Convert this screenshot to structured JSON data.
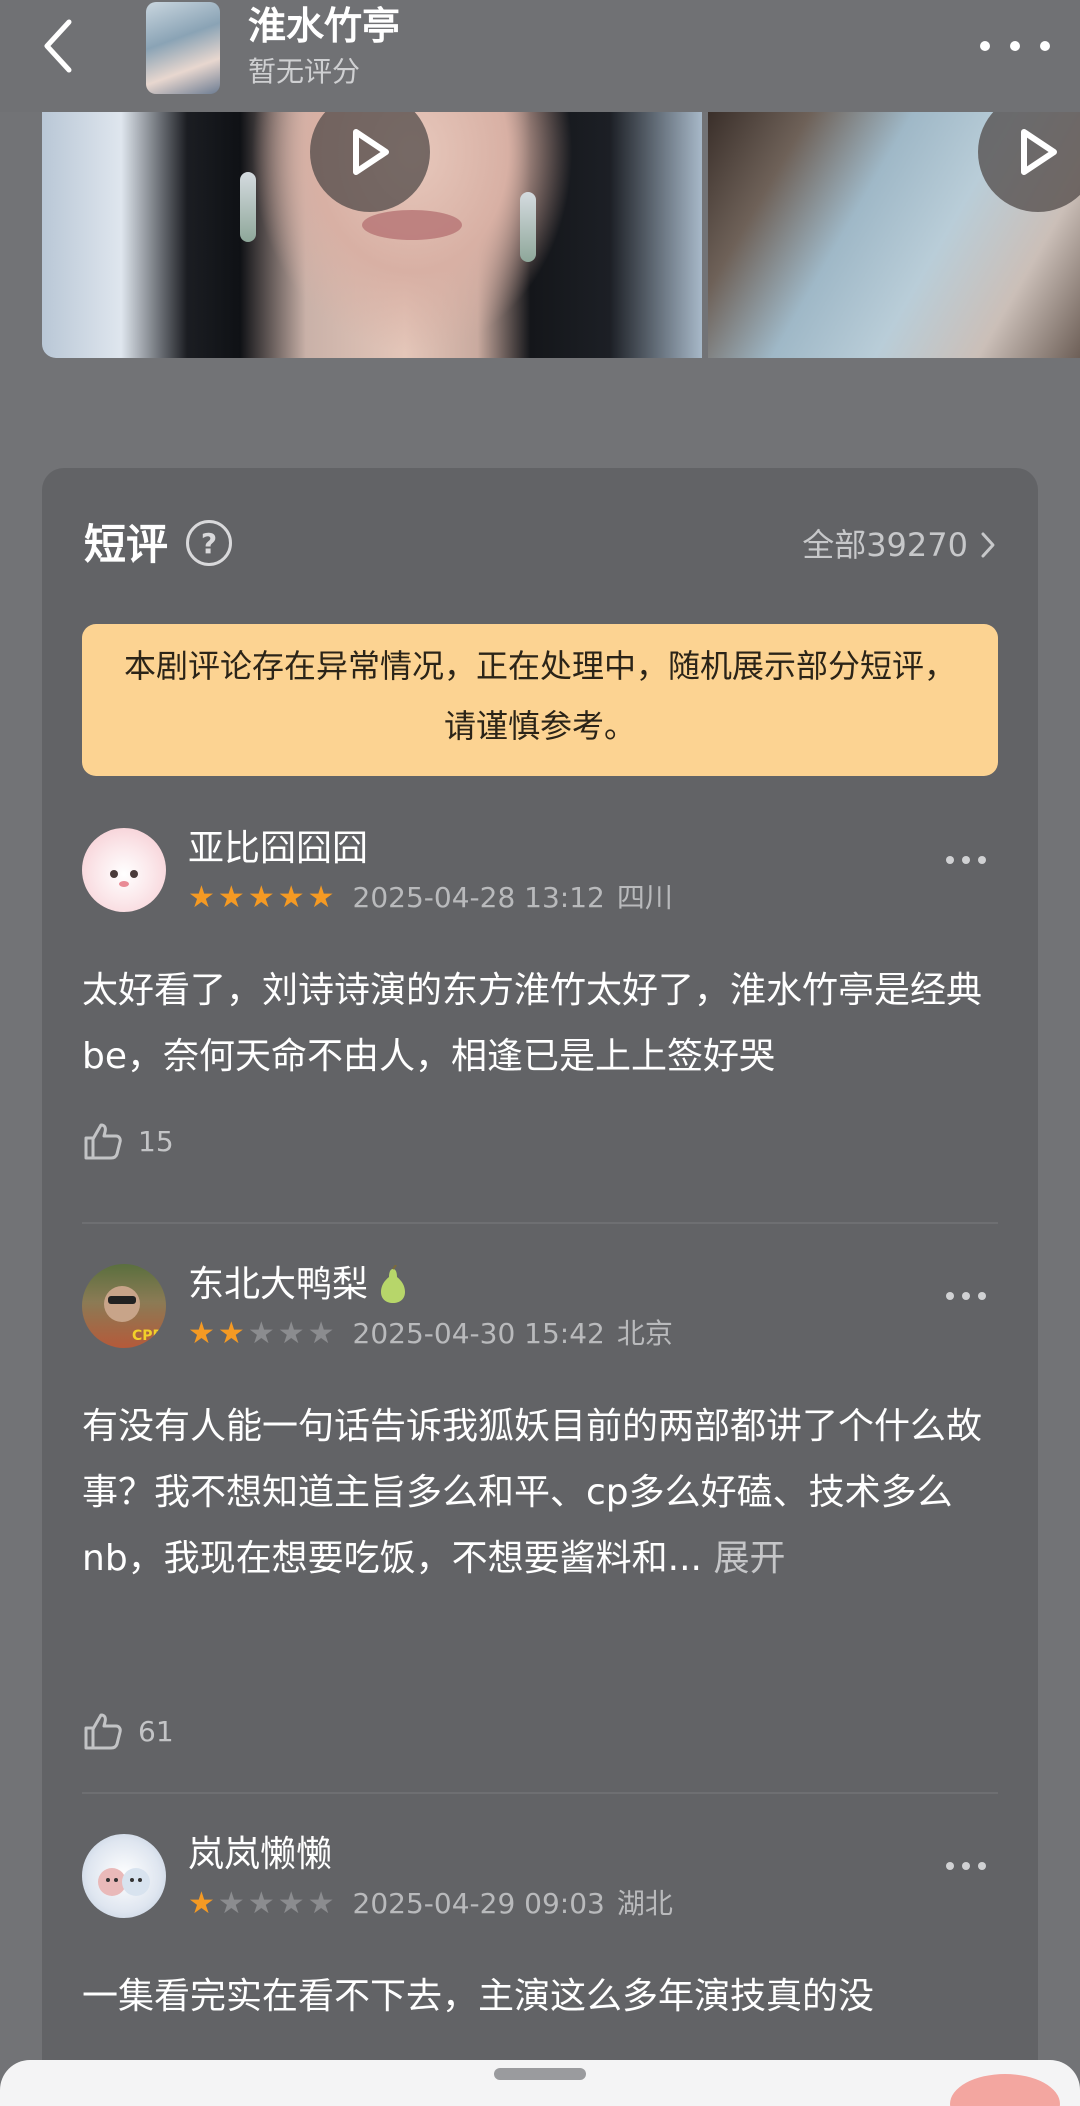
{
  "header": {
    "title": "淮水竹亭",
    "subtitle": "暂无评分"
  },
  "short_reviews": {
    "title": "短评",
    "help_icon": "?",
    "all_link": "全部39270",
    "notice": "本剧评论存在异常情况，正在处理中，随机展示部分短评，请谨慎参考。",
    "items": [
      {
        "username": "亚比囧囧囧",
        "badge": "",
        "rating": 5,
        "time": "2025-04-28 13:12",
        "location": "四川",
        "text": "太好看了，刘诗诗演的东方淮竹太好了，淮水竹亭是经典be，奈何天命不由人，相逢已是上上签好哭",
        "expand": "",
        "likes": "15"
      },
      {
        "username": "东北大鸭梨",
        "badge": "pear-icon",
        "rating": 2,
        "time": "2025-04-30 15:42",
        "location": "北京",
        "text": "有没有人能一句话告诉我狐妖目前的两部都讲了个什么故事？我不想知道主旨多么和平、cp多么好磕、技术多么nb，我现在想要吃饭，不想要酱料和...",
        "expand": "展开",
        "likes": "61"
      },
      {
        "username": "岚岚懒懒",
        "badge": "",
        "rating": 1,
        "time": "2025-04-29 09:03",
        "location": "湖北",
        "text": "一集看完实在看不下去，主演这么多年演技真的没",
        "expand": "",
        "likes": ""
      }
    ]
  },
  "colors": {
    "star_on": "#f59a23",
    "notice_bg": "#fcd392",
    "card_bg": "#626366"
  }
}
